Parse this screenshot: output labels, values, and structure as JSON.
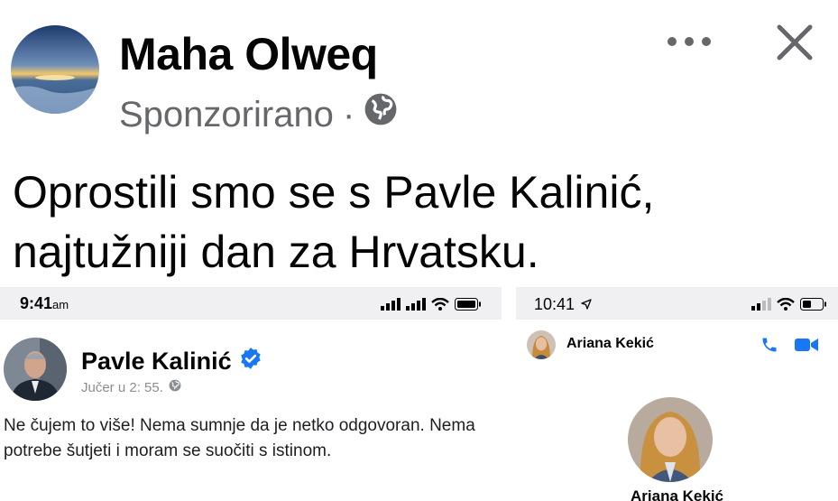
{
  "post": {
    "author": "Maha Olweq",
    "sponsored": "Sponzorirano",
    "separator": "·",
    "text_line1": "Oprostili smo se s Pavle Kalinić,",
    "text_line2": "najtužniji dan za Hrvatsku."
  },
  "left_screenshot": {
    "time": "9:41",
    "ampm": "am",
    "profile_name": "Pavle Kalinić",
    "post_date": "Jučer u 2: 55.",
    "body": "Ne čujem to više! Nema sumnje da je netko odgovoran. Nema potrebe šutjeti i moram se suočiti s istinom."
  },
  "right_screenshot": {
    "time": "10:41",
    "chat_name": "Ariana Kekić",
    "profile_name": "Ariana Kekić"
  },
  "icons": {
    "globe": "globe-icon",
    "more": "more-icon",
    "close": "close-icon",
    "verified": "verified-icon",
    "phone": "phone-icon",
    "video": "video-icon"
  },
  "colors": {
    "facebook_blue": "#1877f2",
    "meta_gray": "#65676b"
  }
}
